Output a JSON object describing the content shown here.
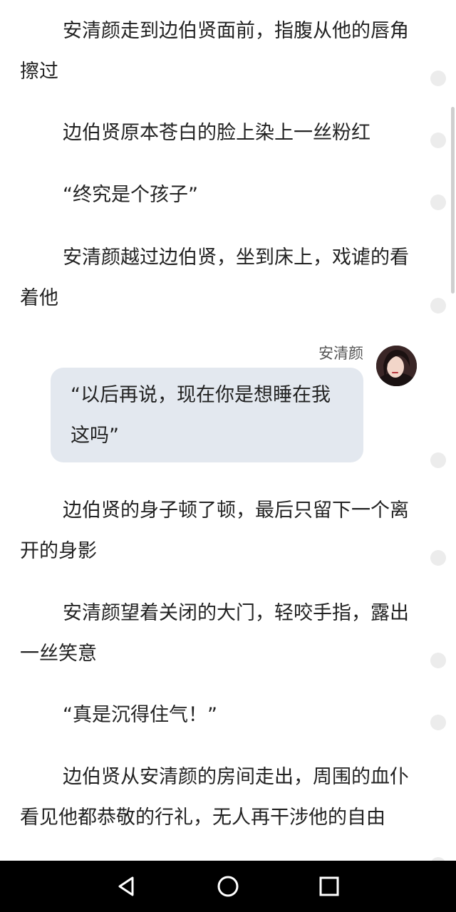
{
  "paragraphs": [
    "安清颜走到边伯贤面前，指腹从他的唇角擦过",
    "边伯贤原本苍白的脸上染上一丝粉红",
    "“终究是个孩子”",
    "安清颜越过边伯贤，坐到床上，戏谑的看着他",
    "边伯贤的身子顿了顿，最后只留下一个离开的身影",
    "安清颜望着关闭的大门，轻咬手指，露出一丝笑意",
    "“真是沉得住气！”",
    "边伯贤从安清颜的房间走出，周围的血仆看见他都恭敬的行礼，无人再干涉他的自由"
  ],
  "dialogue": {
    "speaker": "安清颜",
    "text": "“以后再说，现在你是想睡在我这吗”"
  },
  "navbar": {
    "back": "back-icon",
    "home": "home-icon",
    "recents": "recents-icon"
  },
  "colors": {
    "bubble": "#e3e8ef",
    "dot": "#ececec",
    "navbar": "#000000"
  }
}
